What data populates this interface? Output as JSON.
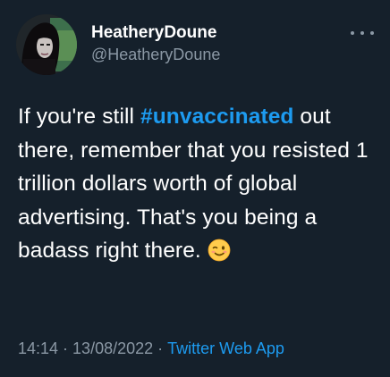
{
  "tweet": {
    "author": {
      "display_name": "HeatheryDoune",
      "handle": "@HeatheryDoune",
      "avatar_icon": "avatar-icon"
    },
    "more_icon": "more-icon",
    "text_before": "If you're still ",
    "hashtag": "#unvaccinated",
    "text_after": " out there, remember that you resisted 1 trillion dollars worth of global advertising. That's you being a badass right there. ",
    "emoji_icon": "winking-face-emoji",
    "time": "14:14",
    "separator": "·",
    "date": "13/08/2022",
    "source": "Twitter Web App"
  },
  "colors": {
    "background": "#15202b",
    "text": "#ffffff",
    "secondary": "#8b98a5",
    "accent": "#1d9bf0"
  }
}
